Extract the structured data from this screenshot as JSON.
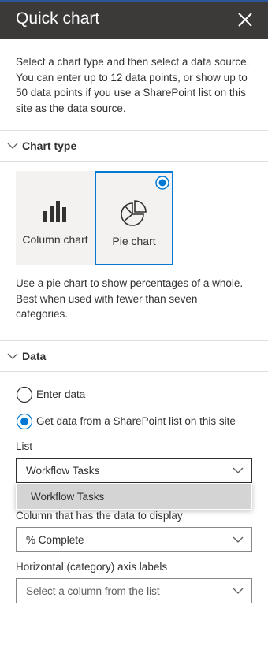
{
  "panel": {
    "title": "Quick chart",
    "intro": "Select a chart type and then select a data source. You can enter up to 12 data points, or show up to 50 data points if you use a SharePoint list on this site as the data source."
  },
  "chart_type_section": {
    "heading": "Chart type",
    "options": [
      {
        "label": "Column chart",
        "icon": "column-chart-icon",
        "selected": false
      },
      {
        "label": "Pie chart",
        "icon": "pie-chart-icon",
        "selected": true
      }
    ],
    "description": "Use a pie chart to show percentages of a whole. Best when used with fewer than seven categories."
  },
  "data_section": {
    "heading": "Data",
    "source_options": [
      {
        "label": "Enter data",
        "selected": false
      },
      {
        "label": "Get data from a SharePoint list on this site",
        "selected": true
      }
    ],
    "list_label": "List",
    "list_value": "Workflow Tasks",
    "list_options": [
      "Workflow Tasks"
    ],
    "column_label": "Column that has the data to display",
    "column_value": "% Complete",
    "axis_label": "Horizontal (category) axis labels",
    "axis_placeholder": "Select a column from the list"
  },
  "colors": {
    "header_bg": "#3b3a39",
    "accent": "#0078d4",
    "menu_highlight": "#d4d4d4"
  }
}
